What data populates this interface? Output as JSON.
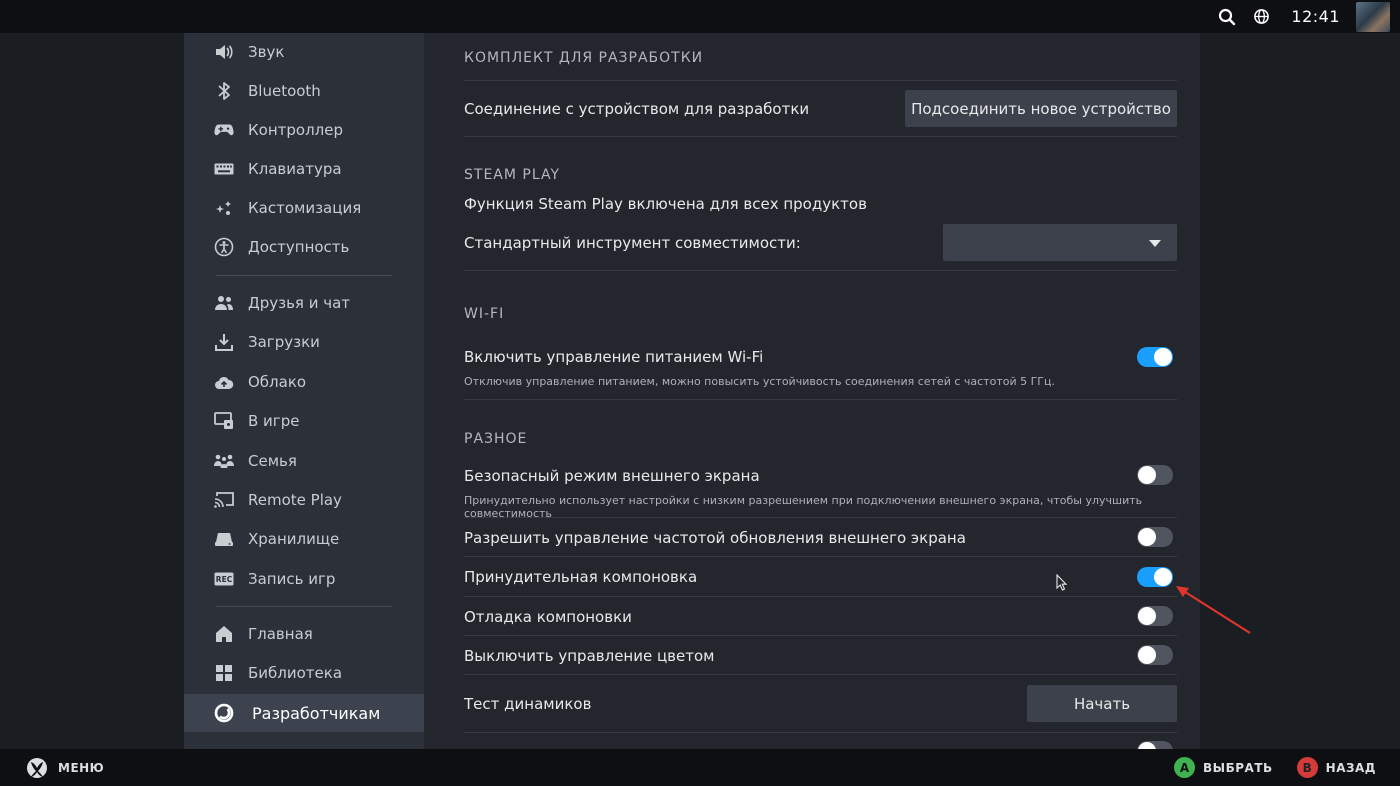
{
  "topbar": {
    "clock": "12:41"
  },
  "sidebar": {
    "items": [
      {
        "label": "Звук",
        "icon": "speaker-icon"
      },
      {
        "label": "Bluetooth",
        "icon": "bluetooth-icon"
      },
      {
        "label": "Контроллер",
        "icon": "gamepad-icon"
      },
      {
        "label": "Клавиатура",
        "icon": "keyboard-icon"
      },
      {
        "label": "Кастомизация",
        "icon": "sparkle-icon"
      },
      {
        "label": "Доступность",
        "icon": "accessibility-icon"
      },
      {
        "label": "Друзья и чат",
        "icon": "friends-icon"
      },
      {
        "label": "Загрузки",
        "icon": "download-icon"
      },
      {
        "label": "Облако",
        "icon": "cloud-icon"
      },
      {
        "label": "В игре",
        "icon": "in-game-icon"
      },
      {
        "label": "Семья",
        "icon": "family-icon"
      },
      {
        "label": "Remote Play",
        "icon": "remote-play-icon"
      },
      {
        "label": "Хранилище",
        "icon": "storage-icon"
      },
      {
        "label": "Запись игр",
        "icon": "rec-icon"
      },
      {
        "label": "Главная",
        "icon": "home-icon"
      },
      {
        "label": "Библиотека",
        "icon": "library-icon"
      },
      {
        "label": "Разработчикам",
        "icon": "developer-icon"
      }
    ]
  },
  "main": {
    "devkit": {
      "title": "КОМПЛЕКТ ДЛЯ РАЗРАБОТКИ",
      "connection_label": "Соединение с устройством для разработки",
      "connect_button": "Подсоединить новое устройство"
    },
    "steamplay": {
      "title": "STEAM PLAY",
      "enabled_text": "Функция Steam Play включена для всех продуктов",
      "compat_label": "Стандартный инструмент совместимости:",
      "compat_value": ""
    },
    "wifi": {
      "title": "WI-FI",
      "power_label": "Включить управление питанием Wi-Fi",
      "power_desc": "Отключив управление питанием, можно повысить устойчивость соединения сетей с частотой 5 ГГц.",
      "power_on": true
    },
    "misc": {
      "title": "РАЗНОЕ",
      "safe_mode_label": "Безопасный режим внешнего экрана",
      "safe_mode_desc": "Принудительно использует настройки с низким разрешением при подключении внешнего экрана, чтобы улучшить совместимость",
      "safe_mode_on": false,
      "refresh_label": "Разрешить управление частотой обновления внешнего экрана",
      "refresh_on": false,
      "composite_label": "Принудительная компоновка",
      "composite_on": true,
      "composite_debug_label": "Отладка компоновки",
      "composite_debug_on": false,
      "color_label": "Выключить управление цветом",
      "color_on": false,
      "speaker_test_label": "Тест динамиков",
      "speaker_test_button": "Начать"
    }
  },
  "bottombar": {
    "menu_label": "МЕНЮ",
    "select_key": "A",
    "select_label": "ВЫБРАТЬ",
    "back_key": "B",
    "back_label": "НАЗАД"
  },
  "colors": {
    "accent": "#1a9fff",
    "annotation": "#e0352b"
  }
}
